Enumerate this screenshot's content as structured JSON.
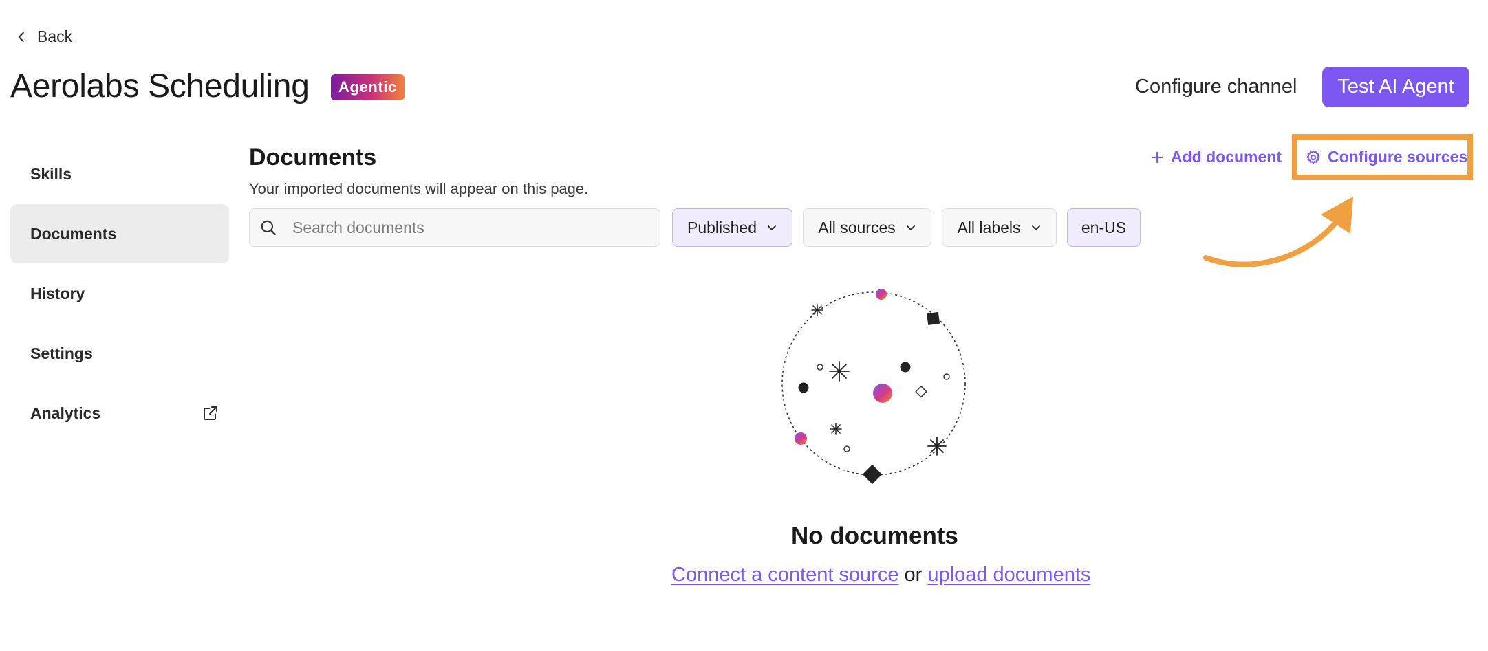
{
  "header": {
    "back_label": "Back",
    "title": "Aerolabs Scheduling",
    "badge": "Agentic",
    "configure_channel": "Configure channel",
    "test_agent": "Test AI Agent"
  },
  "sidebar": {
    "items": [
      {
        "label": "Skills"
      },
      {
        "label": "Documents"
      },
      {
        "label": "History"
      },
      {
        "label": "Settings"
      },
      {
        "label": "Analytics"
      }
    ]
  },
  "documents": {
    "title": "Documents",
    "subtitle": "Your imported documents will appear on this page.",
    "add_document": "Add document",
    "configure_sources": "Configure sources",
    "search_placeholder": "Search documents",
    "filters": {
      "status": "Published",
      "sources": "All sources",
      "labels": "All labels",
      "locale": "en-US"
    },
    "empty": {
      "title": "No documents",
      "link_connect": "Connect a content source",
      "or": " or ",
      "link_upload": "upload documents"
    }
  },
  "colors": {
    "accent": "#7c57f0",
    "highlight": "#f0a040",
    "active_bg": "#ececec"
  },
  "icons": [
    "chevron-left-icon",
    "external-link-icon",
    "plus-icon",
    "gear-icon",
    "search-icon",
    "chevron-down-icon",
    "arrow-annotation"
  ]
}
